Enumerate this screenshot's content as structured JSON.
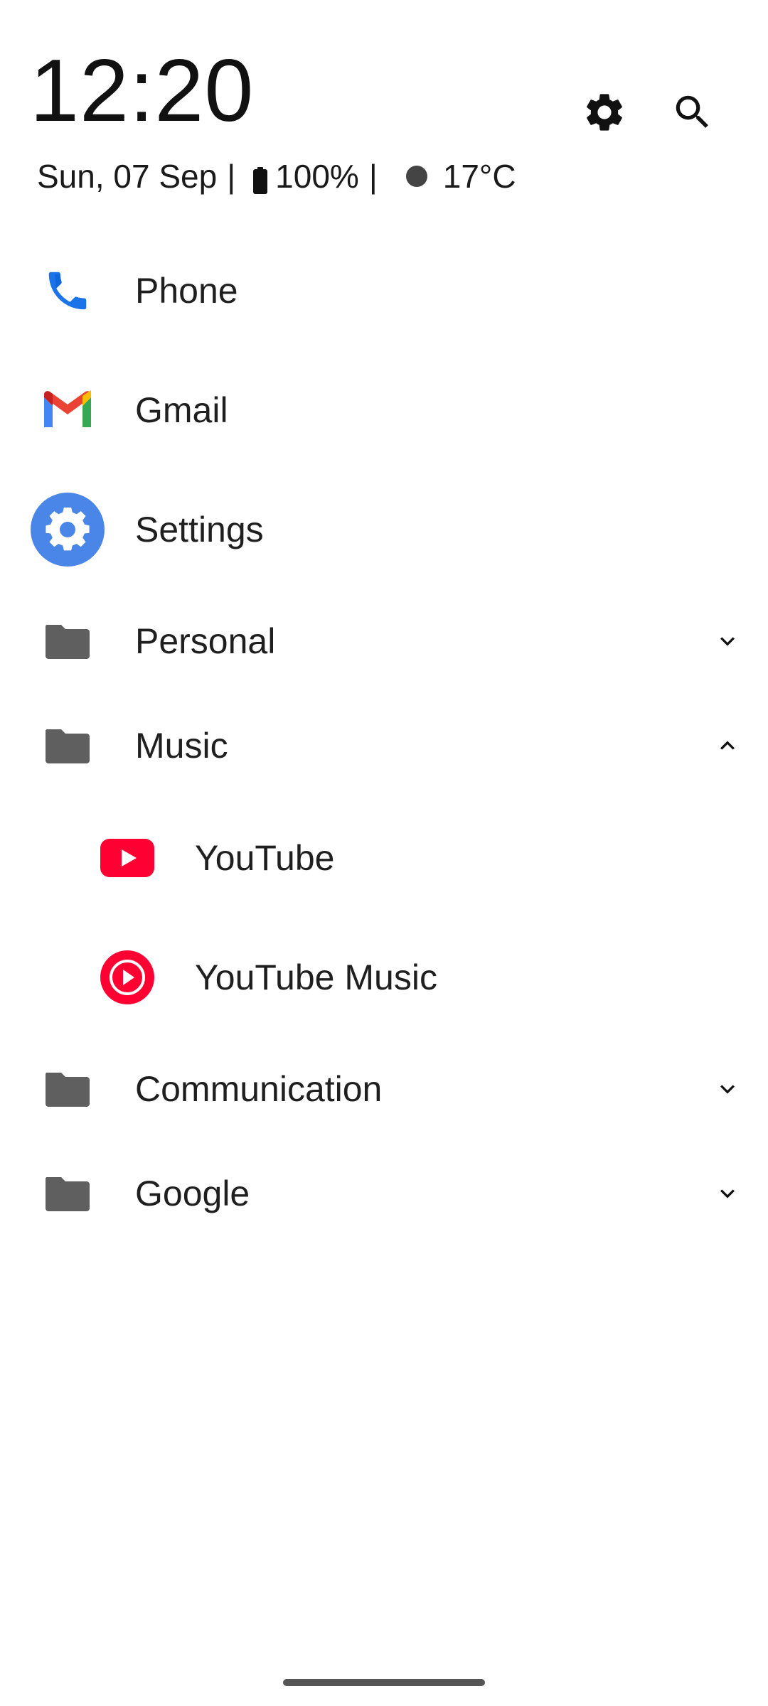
{
  "header": {
    "time": "12:20",
    "date": "Sun, 07 Sep",
    "separator": "|",
    "battery": "100%",
    "temperature": "17°C",
    "settings_icon": "gear-icon",
    "search_icon": "search-icon"
  },
  "apps": [
    {
      "label": "Phone",
      "icon": "phone-icon"
    },
    {
      "label": "Gmail",
      "icon": "gmail-icon"
    },
    {
      "label": "Settings",
      "icon": "settings-app-icon"
    }
  ],
  "folders": [
    {
      "label": "Personal",
      "expanded": false
    },
    {
      "label": "Music",
      "expanded": true,
      "items": [
        {
          "label": "YouTube",
          "icon": "youtube-icon"
        },
        {
          "label": "YouTube Music",
          "icon": "youtube-music-icon"
        }
      ]
    },
    {
      "label": "Communication",
      "expanded": false
    },
    {
      "label": "Google",
      "expanded": false
    }
  ],
  "colors": {
    "folder": "#5f5f5f",
    "youtube_red": "#ff0033",
    "settings_blue": "#4a86e8",
    "phone_blue": "#1a73e8"
  }
}
